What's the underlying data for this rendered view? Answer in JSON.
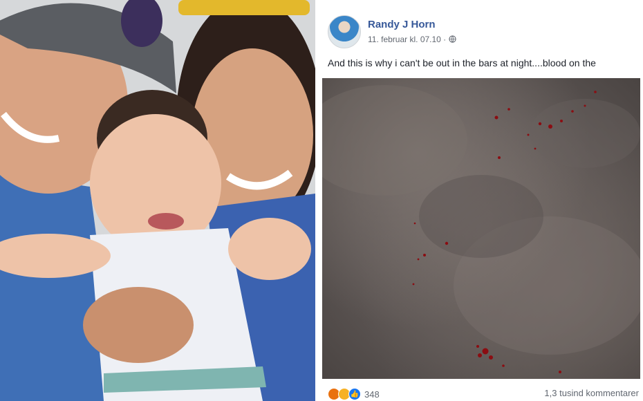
{
  "post": {
    "author": "Randy J Horn",
    "timestamp": "11. februar kl. 07.10 ·",
    "caption": "And this is why i can't be out in the bars at night....blood on the",
    "reactions": {
      "icons": [
        "angry-reaction-icon",
        "wow-reaction-icon",
        "like-reaction-icon"
      ],
      "count": "348"
    },
    "comments": "1,3 tusind kommentarer"
  },
  "colors": {
    "author_link": "#365899",
    "meta_text": "#616770",
    "blood": "#8b0d12"
  }
}
